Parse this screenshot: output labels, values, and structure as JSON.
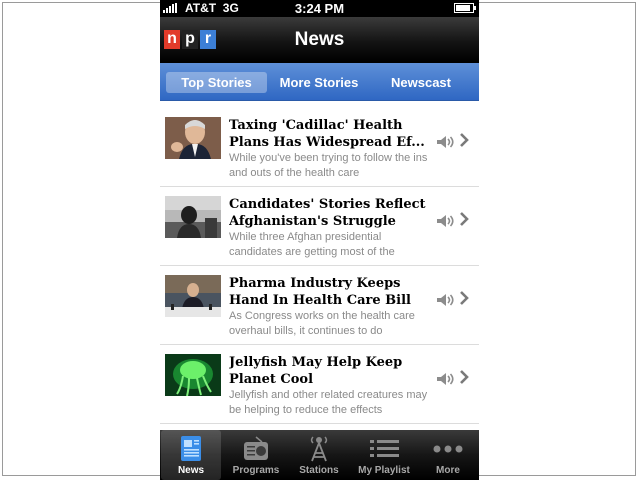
{
  "status_bar": {
    "carrier": "AT&T",
    "network": "3G",
    "time": "3:24 PM",
    "battery_level": 0.85
  },
  "header": {
    "logo": [
      "n",
      "p",
      "r"
    ],
    "logo_colors": [
      "#e23b2a",
      "#222222",
      "#3c7fd6"
    ],
    "title": "News"
  },
  "segments": {
    "items": [
      "Top Stories",
      "More Stories",
      "Newscast"
    ],
    "selected": "Top Stories"
  },
  "stories": [
    {
      "headline": "Taxing 'Cadillac' Health Plans Has Widespread Ef...",
      "summary": "While you've been trying to follow the ins and outs of the health care",
      "thumb": "photo-man-speaking"
    },
    {
      "headline": "Candidates' Stories Reflect Afghanistan's Struggle",
      "summary": "While three Afghan presidential candidates are getting most of the",
      "thumb": "photo-afghan-man"
    },
    {
      "headline": "Pharma Industry Keeps Hand In Health Care Bill",
      "summary": "As Congress works on the health care overhaul bills, it continues to do",
      "thumb": "photo-hearing-table"
    },
    {
      "headline": "Jellyfish May Help Keep Planet Cool",
      "summary": "Jellyfish and other related creatures may be helping to reduce the effects",
      "thumb": "photo-jellyfish"
    }
  ],
  "tab_bar": {
    "items": [
      {
        "label": "News",
        "icon": "news-icon",
        "active": true
      },
      {
        "label": "Programs",
        "icon": "radio-icon",
        "active": false
      },
      {
        "label": "Stations",
        "icon": "antenna-icon",
        "active": false
      },
      {
        "label": "My Playlist",
        "icon": "list-icon",
        "active": false
      },
      {
        "label": "More",
        "icon": "more-icon",
        "active": false
      }
    ]
  },
  "colors": {
    "segment_bar": "#3f77cc",
    "nav_bar": "#1a1a1a",
    "tab_bar": "#111111",
    "summary_text": "#8a8a8a"
  }
}
